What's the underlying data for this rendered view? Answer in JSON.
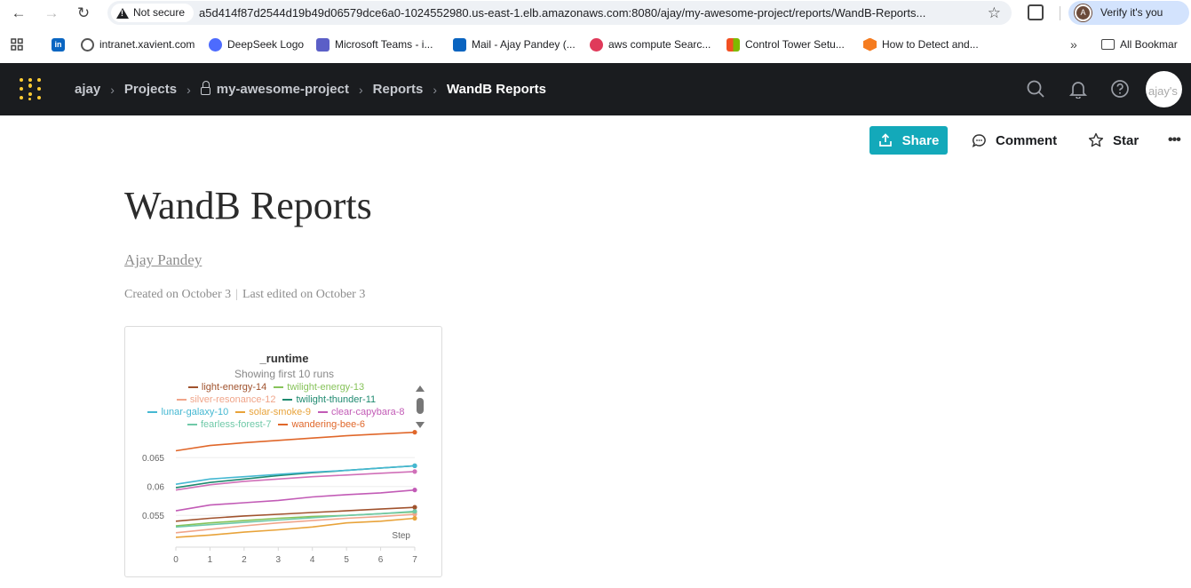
{
  "browser": {
    "security_label": "Not secure",
    "url": "a5d414f87d2544d19b49d06579dce6a0-1024552980.us-east-1.elb.amazonaws.com:8080/ajay/my-awesome-project/reports/WandB-Reports...",
    "verify_label": "Verify it's you",
    "profile_initial": "A"
  },
  "bookmarks": [
    {
      "label": "intranet.xavient.com",
      "color": "#555555"
    },
    {
      "label": "DeepSeek Logo",
      "color": "#4d6bfe"
    },
    {
      "label": "Microsoft Teams - i...",
      "color": "#5b5fc7"
    },
    {
      "label": "Mail - Ajay Pandey (...",
      "color": "#0a64c0"
    },
    {
      "label": "aws compute Searc...",
      "color": "#e03a5a"
    },
    {
      "label": "Control Tower Setu...",
      "color": "#f25022"
    },
    {
      "label": "How to Detect and...",
      "color": "#f57c20"
    }
  ],
  "all_bookmarks_label": "All Bookmar",
  "breadcrumb": {
    "entity": "ajay",
    "projects": "Projects",
    "project": "my-awesome-project",
    "reports": "Reports",
    "current": "WandB Reports"
  },
  "avatar_alt": "ajay's",
  "toolbar": {
    "share": "Share",
    "comment": "Comment",
    "star": "Star",
    "more": "•••"
  },
  "report": {
    "title": "WandB Reports",
    "author": "Ajay Pandey",
    "created": "Created on October 3",
    "edited": "Last edited on October 3"
  },
  "chart_data": {
    "type": "line",
    "title": "_runtime",
    "subtitle": "Showing first 10 runs",
    "xlabel": "Step",
    "ylabel": "",
    "x": [
      0,
      1,
      2,
      3,
      4,
      5,
      6,
      7
    ],
    "xlim": [
      0,
      7
    ],
    "ylim": [
      0.0495,
      0.0695
    ],
    "yticks": [
      0.055,
      0.06,
      0.065
    ],
    "ytick_labels": [
      "0.055",
      "0.06",
      "0.065"
    ],
    "grid": true,
    "legend_position": "top",
    "series": [
      {
        "name": "light-energy-14",
        "color": "#a0522d",
        "values": [
          0.054,
          0.0545,
          0.0549,
          0.0552,
          0.0555,
          0.0558,
          0.0561,
          0.0564
        ]
      },
      {
        "name": "twilight-energy-13",
        "color": "#87c35a",
        "values": [
          0.0532,
          0.0537,
          0.0541,
          0.0545,
          0.0548,
          0.055,
          0.0553,
          0.0556
        ]
      },
      {
        "name": "silver-resonance-12",
        "color": "#f0a58a",
        "values": [
          0.052,
          0.0526,
          0.0532,
          0.0537,
          0.0541,
          0.0545,
          0.0548,
          0.0552
        ]
      },
      {
        "name": "twilight-thunder-11",
        "color": "#1f8a70",
        "values": [
          0.0598,
          0.0607,
          0.0613,
          0.0619,
          0.0624,
          0.0628,
          0.0632,
          0.0636
        ]
      },
      {
        "name": "lunar-galaxy-10",
        "color": "#45b8d2",
        "values": [
          0.0604,
          0.0613,
          0.0617,
          0.0621,
          0.0625,
          0.0628,
          0.0632,
          0.0636
        ]
      },
      {
        "name": "solar-smoke-9",
        "color": "#e8a33a",
        "values": [
          0.0512,
          0.0516,
          0.0521,
          0.0525,
          0.053,
          0.0537,
          0.054,
          0.0545
        ]
      },
      {
        "name": "clear-capybara-8",
        "color": "#c25bb6",
        "values": [
          0.0558,
          0.0568,
          0.0572,
          0.0576,
          0.0582,
          0.0586,
          0.0589,
          0.0594
        ]
      },
      {
        "name": "fearless-forest-7",
        "color": "#6fc9a8",
        "values": [
          0.053,
          0.0534,
          0.0538,
          0.0542,
          0.0546,
          0.055,
          0.0553,
          0.0557
        ]
      },
      {
        "name": "wandering-bee-6",
        "color": "#e0672a",
        "values": [
          0.0662,
          0.0671,
          0.0676,
          0.068,
          0.0684,
          0.0688,
          0.0691,
          0.0694
        ]
      },
      {
        "name": "",
        "color": "#d06fb8",
        "values": [
          0.0594,
          0.0603,
          0.0609,
          0.0613,
          0.0617,
          0.062,
          0.0623,
          0.0626
        ]
      }
    ]
  }
}
